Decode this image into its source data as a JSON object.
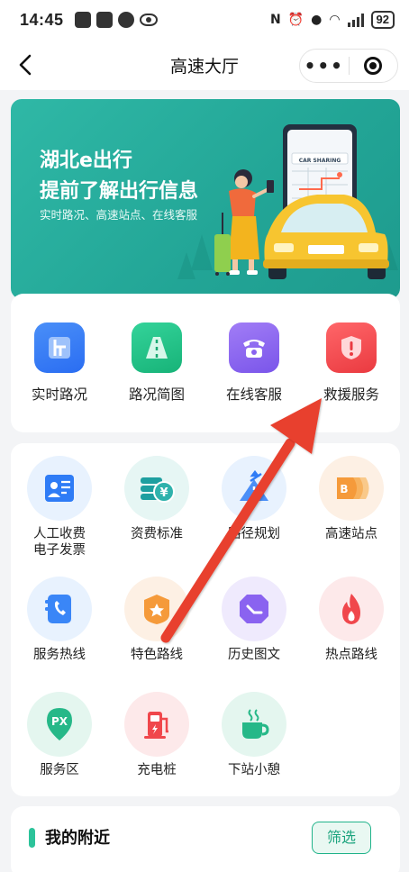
{
  "status_bar": {
    "time": "14:45",
    "battery": "92"
  },
  "header": {
    "title": "高速大厅",
    "more_label": "•••"
  },
  "banner": {
    "line1": "湖北e出行",
    "line2": "提前了解出行信息",
    "line3": "实时路况、高速站点、在线客服",
    "phone_text": "CAR SHARING"
  },
  "quick_actions": [
    {
      "label": "实时路况",
      "icon": "traffic-map-icon",
      "color": "#2f7cf6"
    },
    {
      "label": "路况简图",
      "icon": "road-icon",
      "color": "#1fbe86"
    },
    {
      "label": "在线客服",
      "icon": "telephone-icon",
      "color": "#8a63f0"
    },
    {
      "label": "救援服务",
      "icon": "rescue-shield-icon",
      "color": "#f0474c"
    }
  ],
  "services": [
    {
      "label_line1": "人工收费",
      "label_line2": "电子发票",
      "icon": "invoice-icon"
    },
    {
      "label_line1": "资费标准",
      "label_line2": "",
      "icon": "toll-fee-icon"
    },
    {
      "label_line1": "路径规划",
      "label_line2": "",
      "icon": "route-plan-icon"
    },
    {
      "label_line1": "高速站点",
      "label_line2": "",
      "icon": "station-icon"
    },
    {
      "label_line1": "服务热线",
      "label_line2": "",
      "icon": "hotline-icon"
    },
    {
      "label_line1": "特色路线",
      "label_line2": "",
      "icon": "featured-route-icon"
    },
    {
      "label_line1": "历史图文",
      "label_line2": "",
      "icon": "history-icon"
    },
    {
      "label_line1": "热点路线",
      "label_line2": "",
      "icon": "hot-route-icon"
    },
    {
      "label_line1": "服务区",
      "label_line2": "",
      "icon": "service-area-icon"
    },
    {
      "label_line1": "充电桩",
      "label_line2": "",
      "icon": "charging-pile-icon"
    },
    {
      "label_line1": "下站小憩",
      "label_line2": "",
      "icon": "rest-coffee-icon"
    }
  ],
  "service_icon_glyphs": {
    "toll": "¥",
    "station": "B",
    "px": "PX"
  },
  "nearby": {
    "title": "我的附近",
    "filter_label": "筛选"
  },
  "colors": {
    "accent": "#22a596",
    "filter_green": "#20b38a",
    "annotation_red": "#e8402f"
  }
}
